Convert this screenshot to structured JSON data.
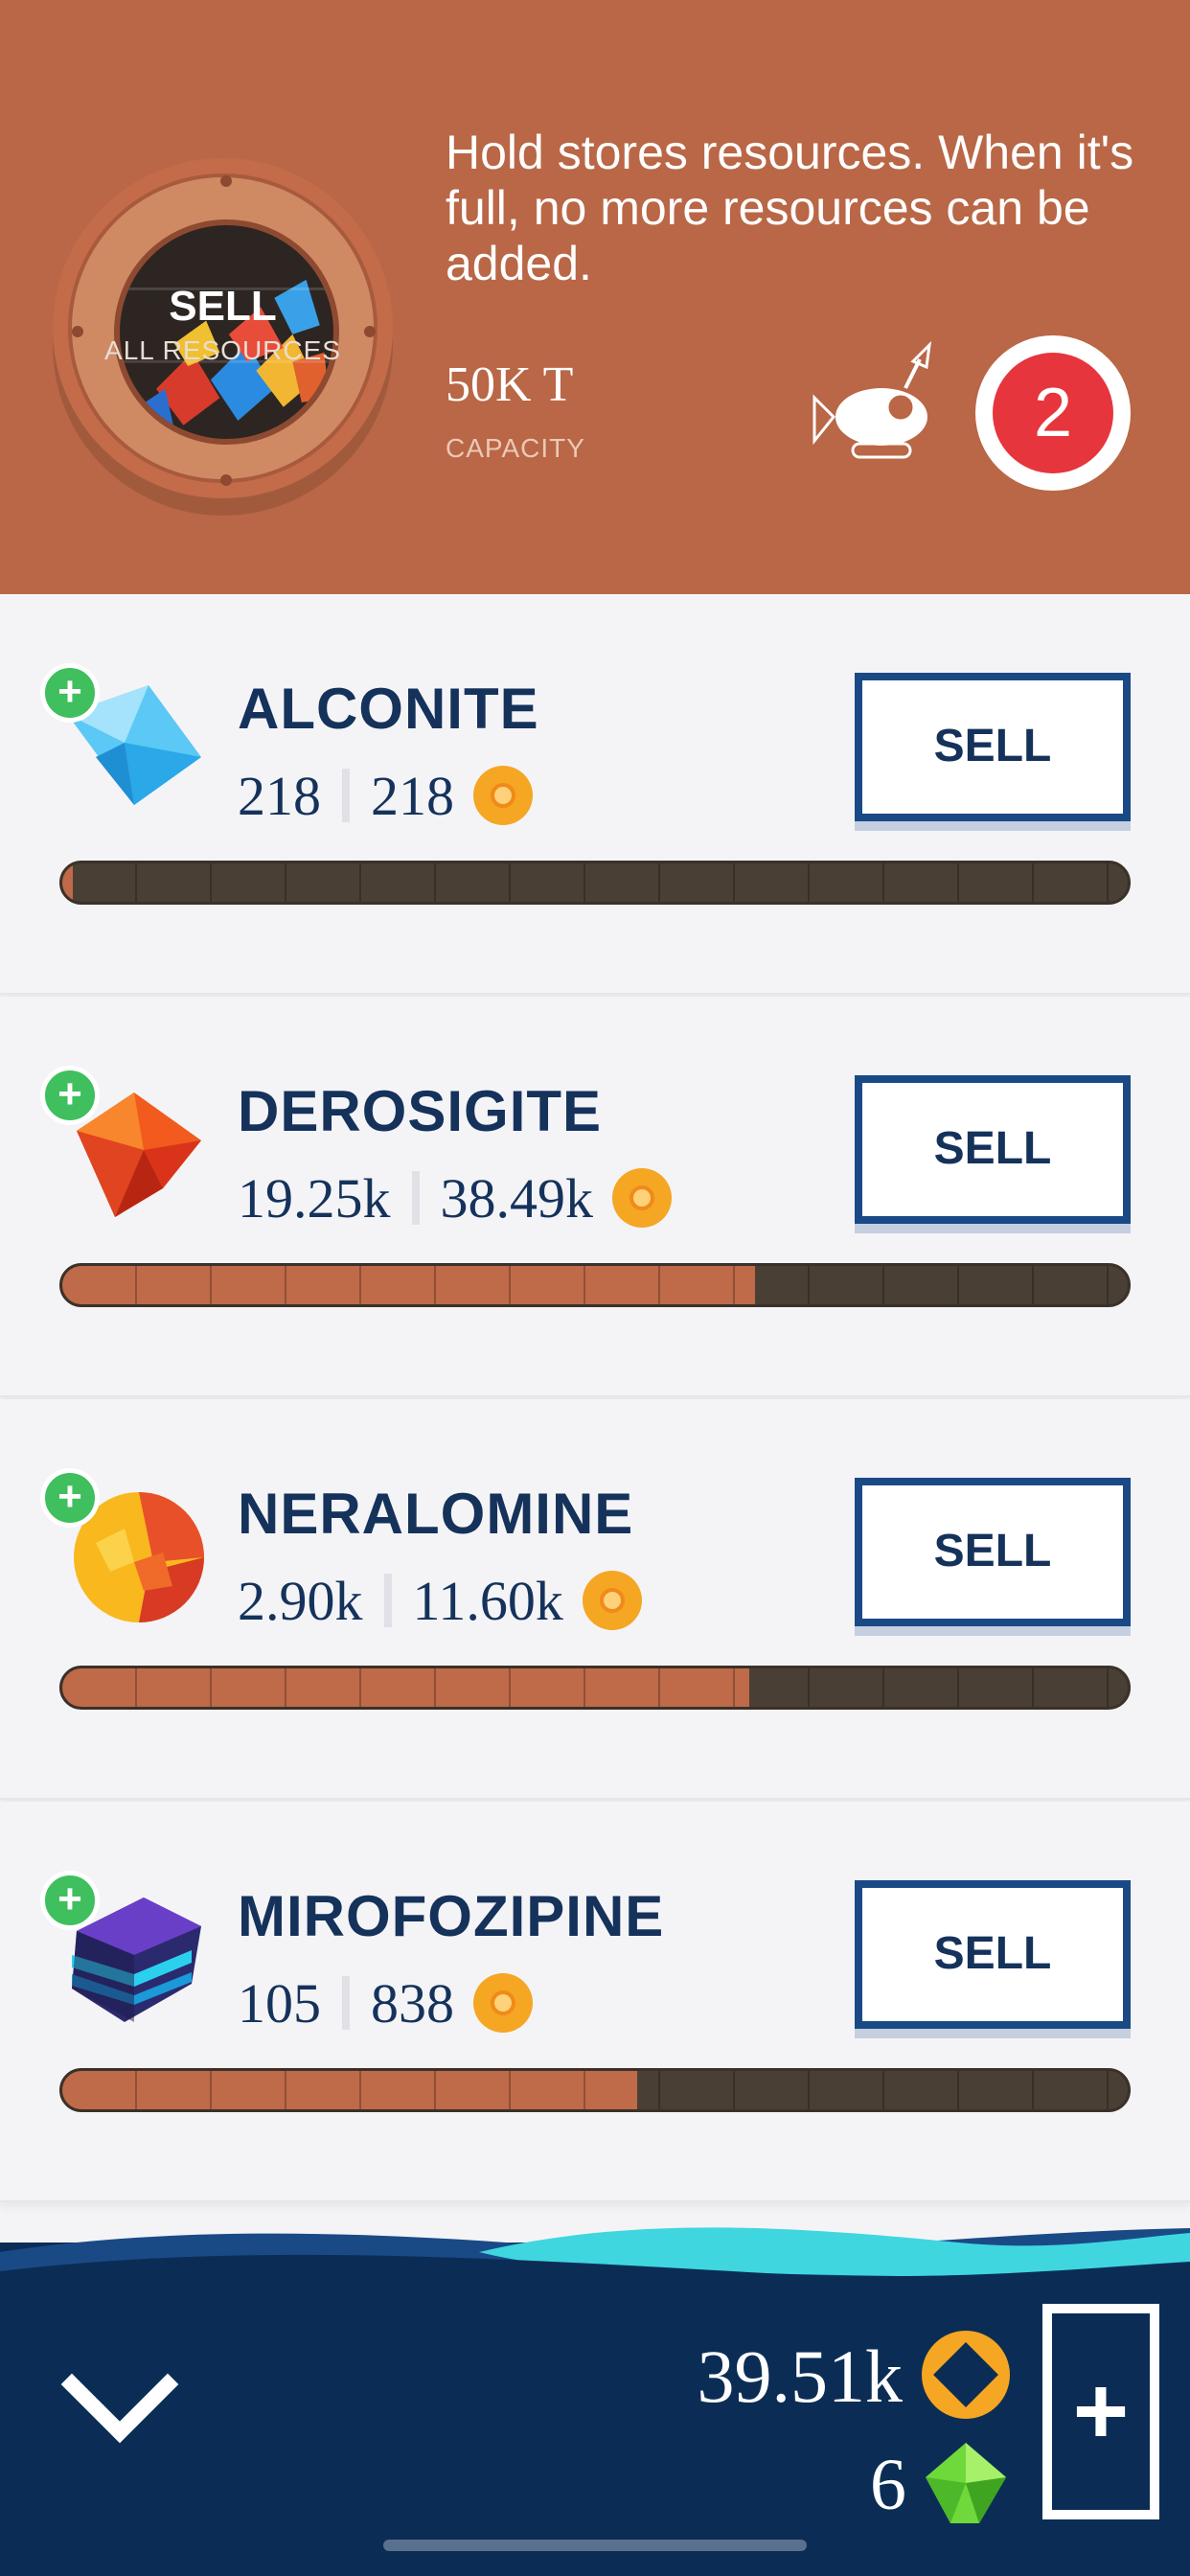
{
  "header": {
    "sell_all_title": "SELL",
    "sell_all_subtitle": "ALL RESOURCES",
    "description": "Hold stores resources. When it's full, no more resources can be added.",
    "capacity_value": "50K T",
    "capacity_label": "CAPACITY",
    "badge_count": "2"
  },
  "resources": [
    {
      "name": "ALCONITE",
      "amount": "218",
      "value": "218",
      "sell_label": "SELL",
      "fill_fraction": 0.01
    },
    {
      "name": "DEROSIGITE",
      "amount": "19.25k",
      "value": "38.49k",
      "sell_label": "SELL",
      "fill_fraction": 0.65
    },
    {
      "name": "NERALOMINE",
      "amount": "2.90k",
      "value": "11.60k",
      "sell_label": "SELL",
      "fill_fraction": 0.645
    },
    {
      "name": "MIROFOZIPINE",
      "amount": "105",
      "value": "838",
      "sell_label": "SELL",
      "fill_fraction": 0.54
    }
  ],
  "footer": {
    "coins": "39.51k",
    "gems": "6"
  },
  "colors": {
    "header_bg": "#b96746",
    "footer_bg": "#0b2d55",
    "accent_blue": "#1a4a86",
    "progress_fill": "#bf6a48"
  },
  "icons": [
    "porthole-icon",
    "robot-icon",
    "plus-icon",
    "coin-icon",
    "gem-icon",
    "chevron-down-icon"
  ]
}
